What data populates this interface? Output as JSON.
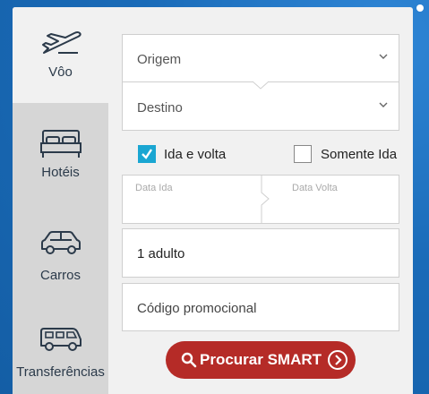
{
  "nav": {
    "flights": {
      "label": "Vôo",
      "icon": "airplane-icon"
    },
    "hotels": {
      "label": "Hotéis",
      "icon": "bed-icon"
    },
    "cars": {
      "label": "Carros",
      "icon": "car-icon"
    },
    "transfers": {
      "label": "Transferências",
      "icon": "van-icon"
    }
  },
  "form": {
    "origin": "Origem",
    "destination": "Destino",
    "round_trip": {
      "label": "Ida e volta",
      "checked": true
    },
    "one_way": {
      "label": "Somente Ida",
      "checked": false
    },
    "departure_date_label": "Data Ida",
    "return_date_label": "Data Volta",
    "passengers": "1 adulto",
    "promo_placeholder": "Código promocional",
    "search_label": "Procurar SMART"
  },
  "colors": {
    "background": "#1565b0",
    "accent": "#1aa6d2",
    "button": "#b52b27"
  }
}
